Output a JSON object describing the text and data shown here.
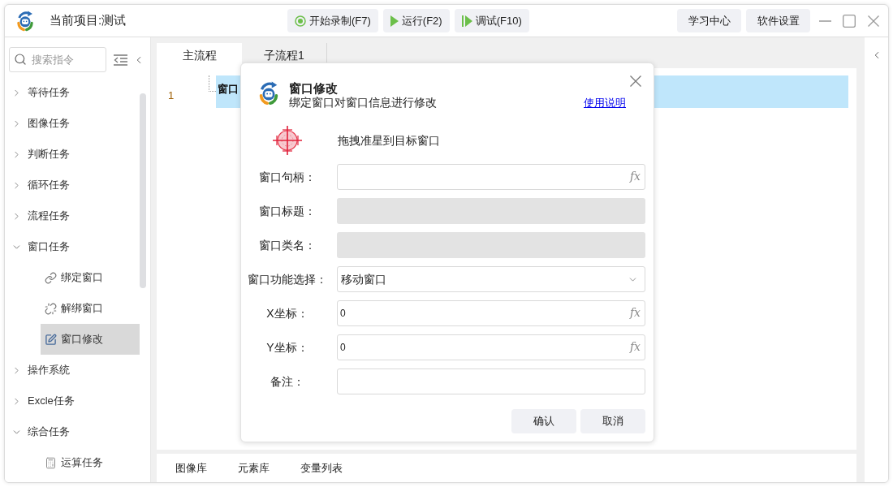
{
  "window": {
    "title": "当前项目:测试"
  },
  "toolbar": [
    {
      "kind": "record",
      "label": "开始录制(F7)"
    },
    {
      "kind": "run",
      "label": "运行(F2)"
    },
    {
      "kind": "debug",
      "label": "调试(F10)"
    }
  ],
  "header_buttons": [
    "学习中心",
    "软件设置"
  ],
  "sidebar": {
    "search": {
      "placeholder": "搜索指令"
    },
    "items": [
      {
        "label": "等待任务",
        "expanded": false
      },
      {
        "label": "图像任务",
        "expanded": false
      },
      {
        "label": "判断任务",
        "expanded": false
      },
      {
        "label": "循环任务",
        "expanded": false
      },
      {
        "label": "流程任务",
        "expanded": false
      },
      {
        "label": "窗口任务",
        "expanded": true,
        "children": [
          {
            "label": "绑定窗口",
            "kind": "link",
            "selected": false
          },
          {
            "label": "解绑窗口",
            "kind": "unlink",
            "selected": false
          },
          {
            "label": "窗口修改",
            "kind": "edit",
            "selected": true
          }
        ]
      },
      {
        "label": "操作系统",
        "expanded": false
      },
      {
        "label": "Excle任务",
        "expanded": false
      },
      {
        "label": "综合任务",
        "expanded": true,
        "children": [
          {
            "label": "运算任务",
            "kind": "calc",
            "selected": false
          }
        ]
      }
    ]
  },
  "tabs": [
    {
      "label": "主流程",
      "selected": true
    },
    {
      "label": "子流程1",
      "selected": false
    }
  ],
  "flow": {
    "lines": [
      {
        "number": "1",
        "text": "窗口",
        "selected": true
      }
    ]
  },
  "bottom_tabs": [
    "图像库",
    "元素库",
    "变量列表"
  ],
  "dialog": {
    "title": "窗口修改",
    "subtitle": "绑定窗口对窗口信息进行修改",
    "help_link": "使用说明",
    "picker_hint": "拖拽准星到目标窗口",
    "fields": [
      {
        "label": "窗口句柄：",
        "kind": "expression",
        "button": "fx",
        "disabled": false
      },
      {
        "label": "窗口标题：",
        "kind": "text",
        "disabled": true
      },
      {
        "label": "窗口类名：",
        "kind": "text",
        "disabled": true
      },
      {
        "label": "窗口功能选择：",
        "kind": "select",
        "value": "移动窗口",
        "disabled": false
      },
      {
        "label": "X坐标：",
        "kind": "expression",
        "value": "0",
        "button": "fx",
        "disabled": false
      },
      {
        "label": "Y坐标：",
        "kind": "expression",
        "value": "0",
        "button": "fx",
        "disabled": false
      },
      {
        "label": "备注：",
        "kind": "text",
        "disabled": false
      }
    ],
    "buttons": [
      "确认",
      "取消"
    ]
  }
}
